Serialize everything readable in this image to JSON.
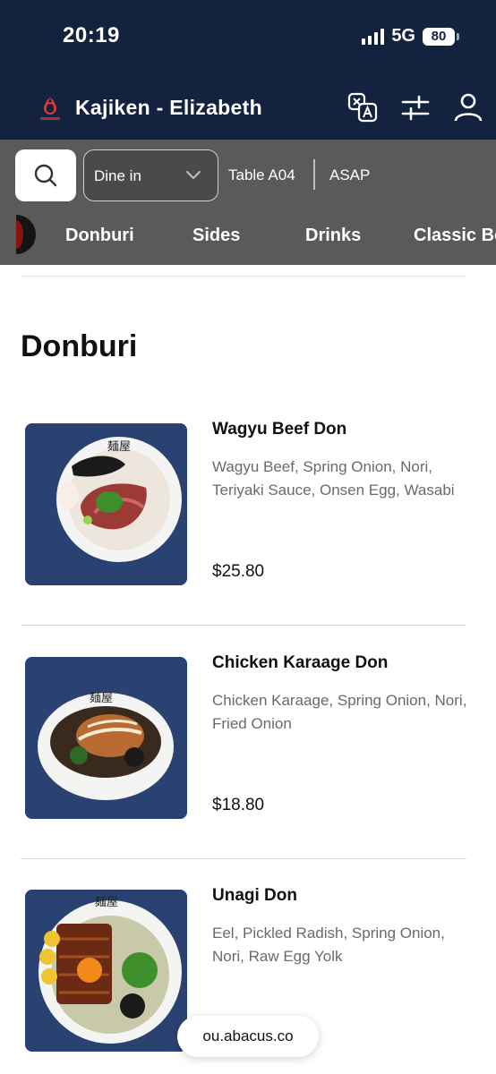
{
  "status_bar": {
    "time": "20:19",
    "network": "5G",
    "battery": "80"
  },
  "header": {
    "store_name": "Kajiken - Elizabeth",
    "logo_text": "KAJIKEN"
  },
  "filters": {
    "order_type": "Dine in",
    "table": "Table A04",
    "timing": "ASAP"
  },
  "categories": [
    "Donburi",
    "Sides",
    "Drinks",
    "Classic Bo"
  ],
  "section": {
    "title": "Donburi"
  },
  "items": [
    {
      "name": "Wagyu Beef Don",
      "description": "Wagyu Beef, Spring Onion, Nori, Teriyaki Sauce, Onsen Egg, Wasabi",
      "price": "$25.80"
    },
    {
      "name": "Chicken Karaage Don",
      "description": "Chicken Karaage, Spring Onion, Nori, Fried Onion",
      "price": "$18.80"
    },
    {
      "name": "Unagi Don",
      "description": "Eel, Pickled Radish, Spring Onion, Nori, Raw Egg Yolk",
      "price": ""
    }
  ],
  "browser": {
    "url": "ou.abacus.co"
  },
  "colors": {
    "header_bg": "#13223f",
    "filter_bar_bg": "#5a5a5a",
    "logo_red": "#e03a2f"
  },
  "icons": [
    "search-icon",
    "chevron-down-icon",
    "translate-icon",
    "filter-icon",
    "account-icon"
  ]
}
